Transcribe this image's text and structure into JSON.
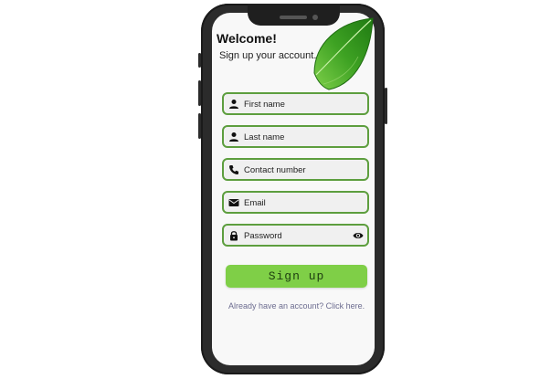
{
  "header": {
    "title": "Welcome!",
    "subtitle": "Sign up your account."
  },
  "form": {
    "fields": [
      {
        "placeholder": "First name",
        "icon": "person-icon"
      },
      {
        "placeholder": "Last name",
        "icon": "person-icon"
      },
      {
        "placeholder": "Contact number",
        "icon": "phone-icon"
      },
      {
        "placeholder": "Email",
        "icon": "mail-icon"
      },
      {
        "placeholder": "Password",
        "icon": "lock-icon"
      }
    ],
    "signup_label": "Sign up",
    "login_link": "Already have an account? Click here."
  },
  "colors": {
    "accent": "#7fcf47",
    "field_border": "#5d9e3e",
    "leaf": "#3a9a1f"
  }
}
